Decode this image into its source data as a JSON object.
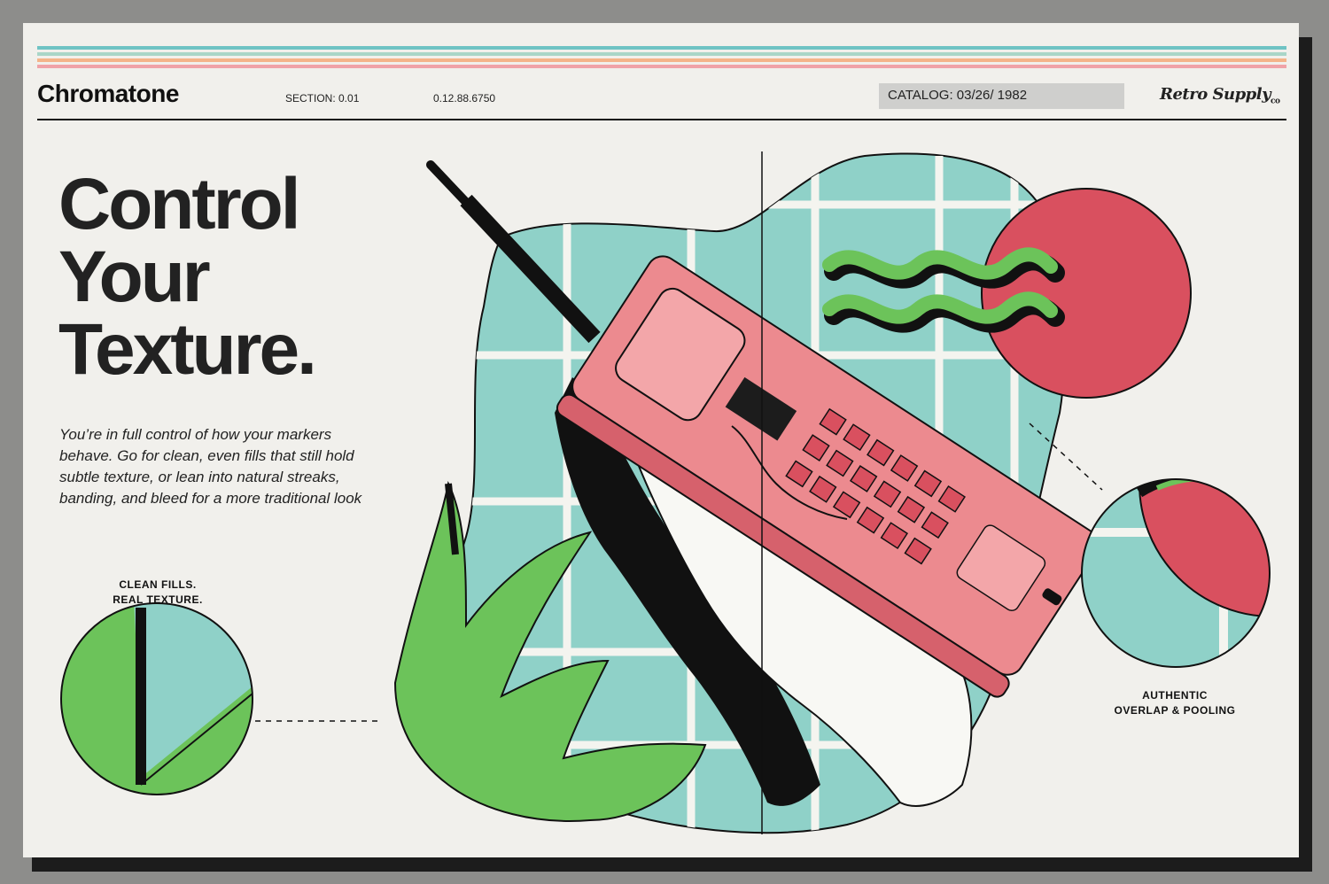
{
  "header": {
    "brand": "Chromatone",
    "section": "SECTION: 0.01",
    "code": "0.12.88.6750",
    "catalog": "CATALOG: 03/26/ 1982",
    "logo": "Retro Supply",
    "logo_suffix": "co"
  },
  "hero": {
    "headline_lines": [
      "Control",
      "Your",
      "Texture."
    ],
    "body": "You’re in full control of how your markers behave. Go for clean, even fills that still hold subtle texture, or lean into natural streaks, banding, and bleed for a more traditional look"
  },
  "callouts": {
    "left": [
      "CLEAN FILLS.",
      "REAL TEXTURE."
    ],
    "right": [
      "AUTHENTIC",
      "OVERLAP & POOLING"
    ]
  },
  "colors": {
    "teal": "#8fd1c8",
    "pink": "#ec8a8f",
    "red": "#d9505f",
    "green": "#6cc35a",
    "ink": "#111111",
    "paper": "#f1f0ec"
  },
  "icons": [
    "handheld-phone-icon",
    "wave-icon",
    "hand-icon"
  ]
}
